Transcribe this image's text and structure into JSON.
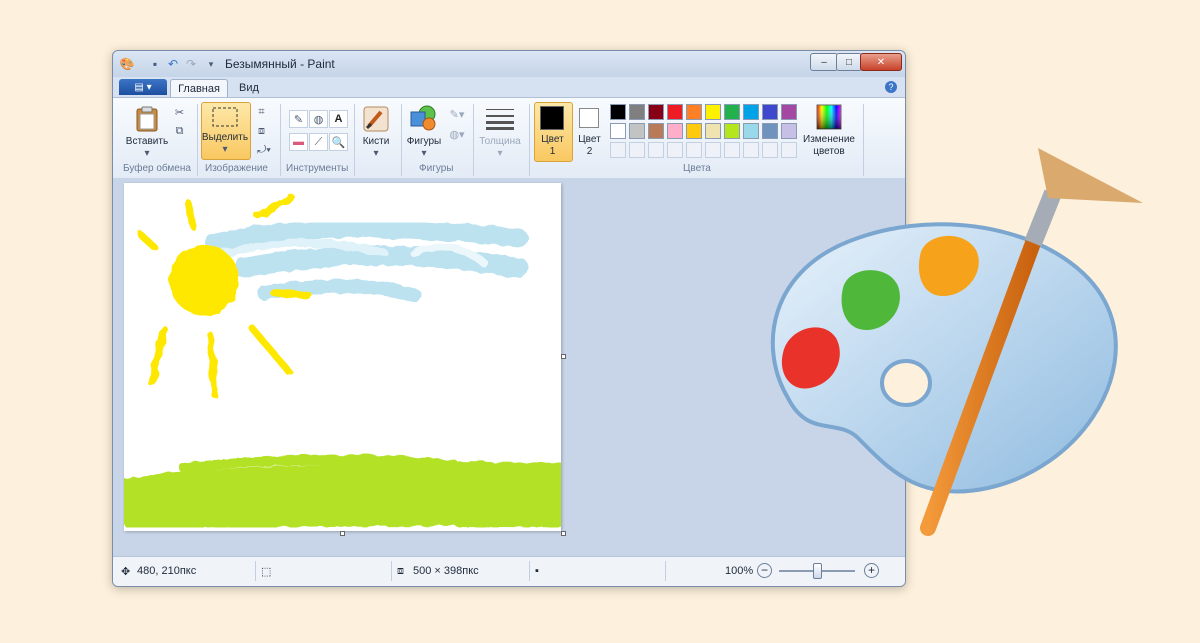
{
  "window": {
    "title": "Безымянный - Paint"
  },
  "tabs": [
    {
      "label": "Главная"
    },
    {
      "label": "Вид"
    }
  ],
  "groups": {
    "clipboard": "Буфер обмена",
    "image": "Изображение",
    "tools": "Инструменты",
    "shapes": "Фигуры",
    "colors": "Цвета"
  },
  "buttons": {
    "paste": "Вставить",
    "select": "Выделить",
    "brushes": "Кисти",
    "shapes": "Фигуры",
    "thickness": "Толщина",
    "color1_a": "Цвет",
    "color1_b": "1",
    "color2_a": "Цвет",
    "color2_b": "2",
    "edit_colors_a": "Изменение",
    "edit_colors_b": "цветов"
  },
  "colors": {
    "row1": [
      "#000000",
      "#7f7f7f",
      "#880015",
      "#ed1c24",
      "#ff7f27",
      "#fff200",
      "#22b14c",
      "#00a2e8",
      "#3f48cc",
      "#a349a4"
    ],
    "row2": [
      "#ffffff",
      "#c3c3c3",
      "#b97a57",
      "#ffaec9",
      "#ffc90e",
      "#efe4b0",
      "#b5e61d",
      "#99d9ea",
      "#7092be",
      "#c8bfe7"
    ],
    "color1": "#000000",
    "color2": "#ffffff"
  },
  "status": {
    "cursor_pos": "480, 210пкс",
    "canvas_size": "500 × 398пкс",
    "zoom": "100%"
  }
}
